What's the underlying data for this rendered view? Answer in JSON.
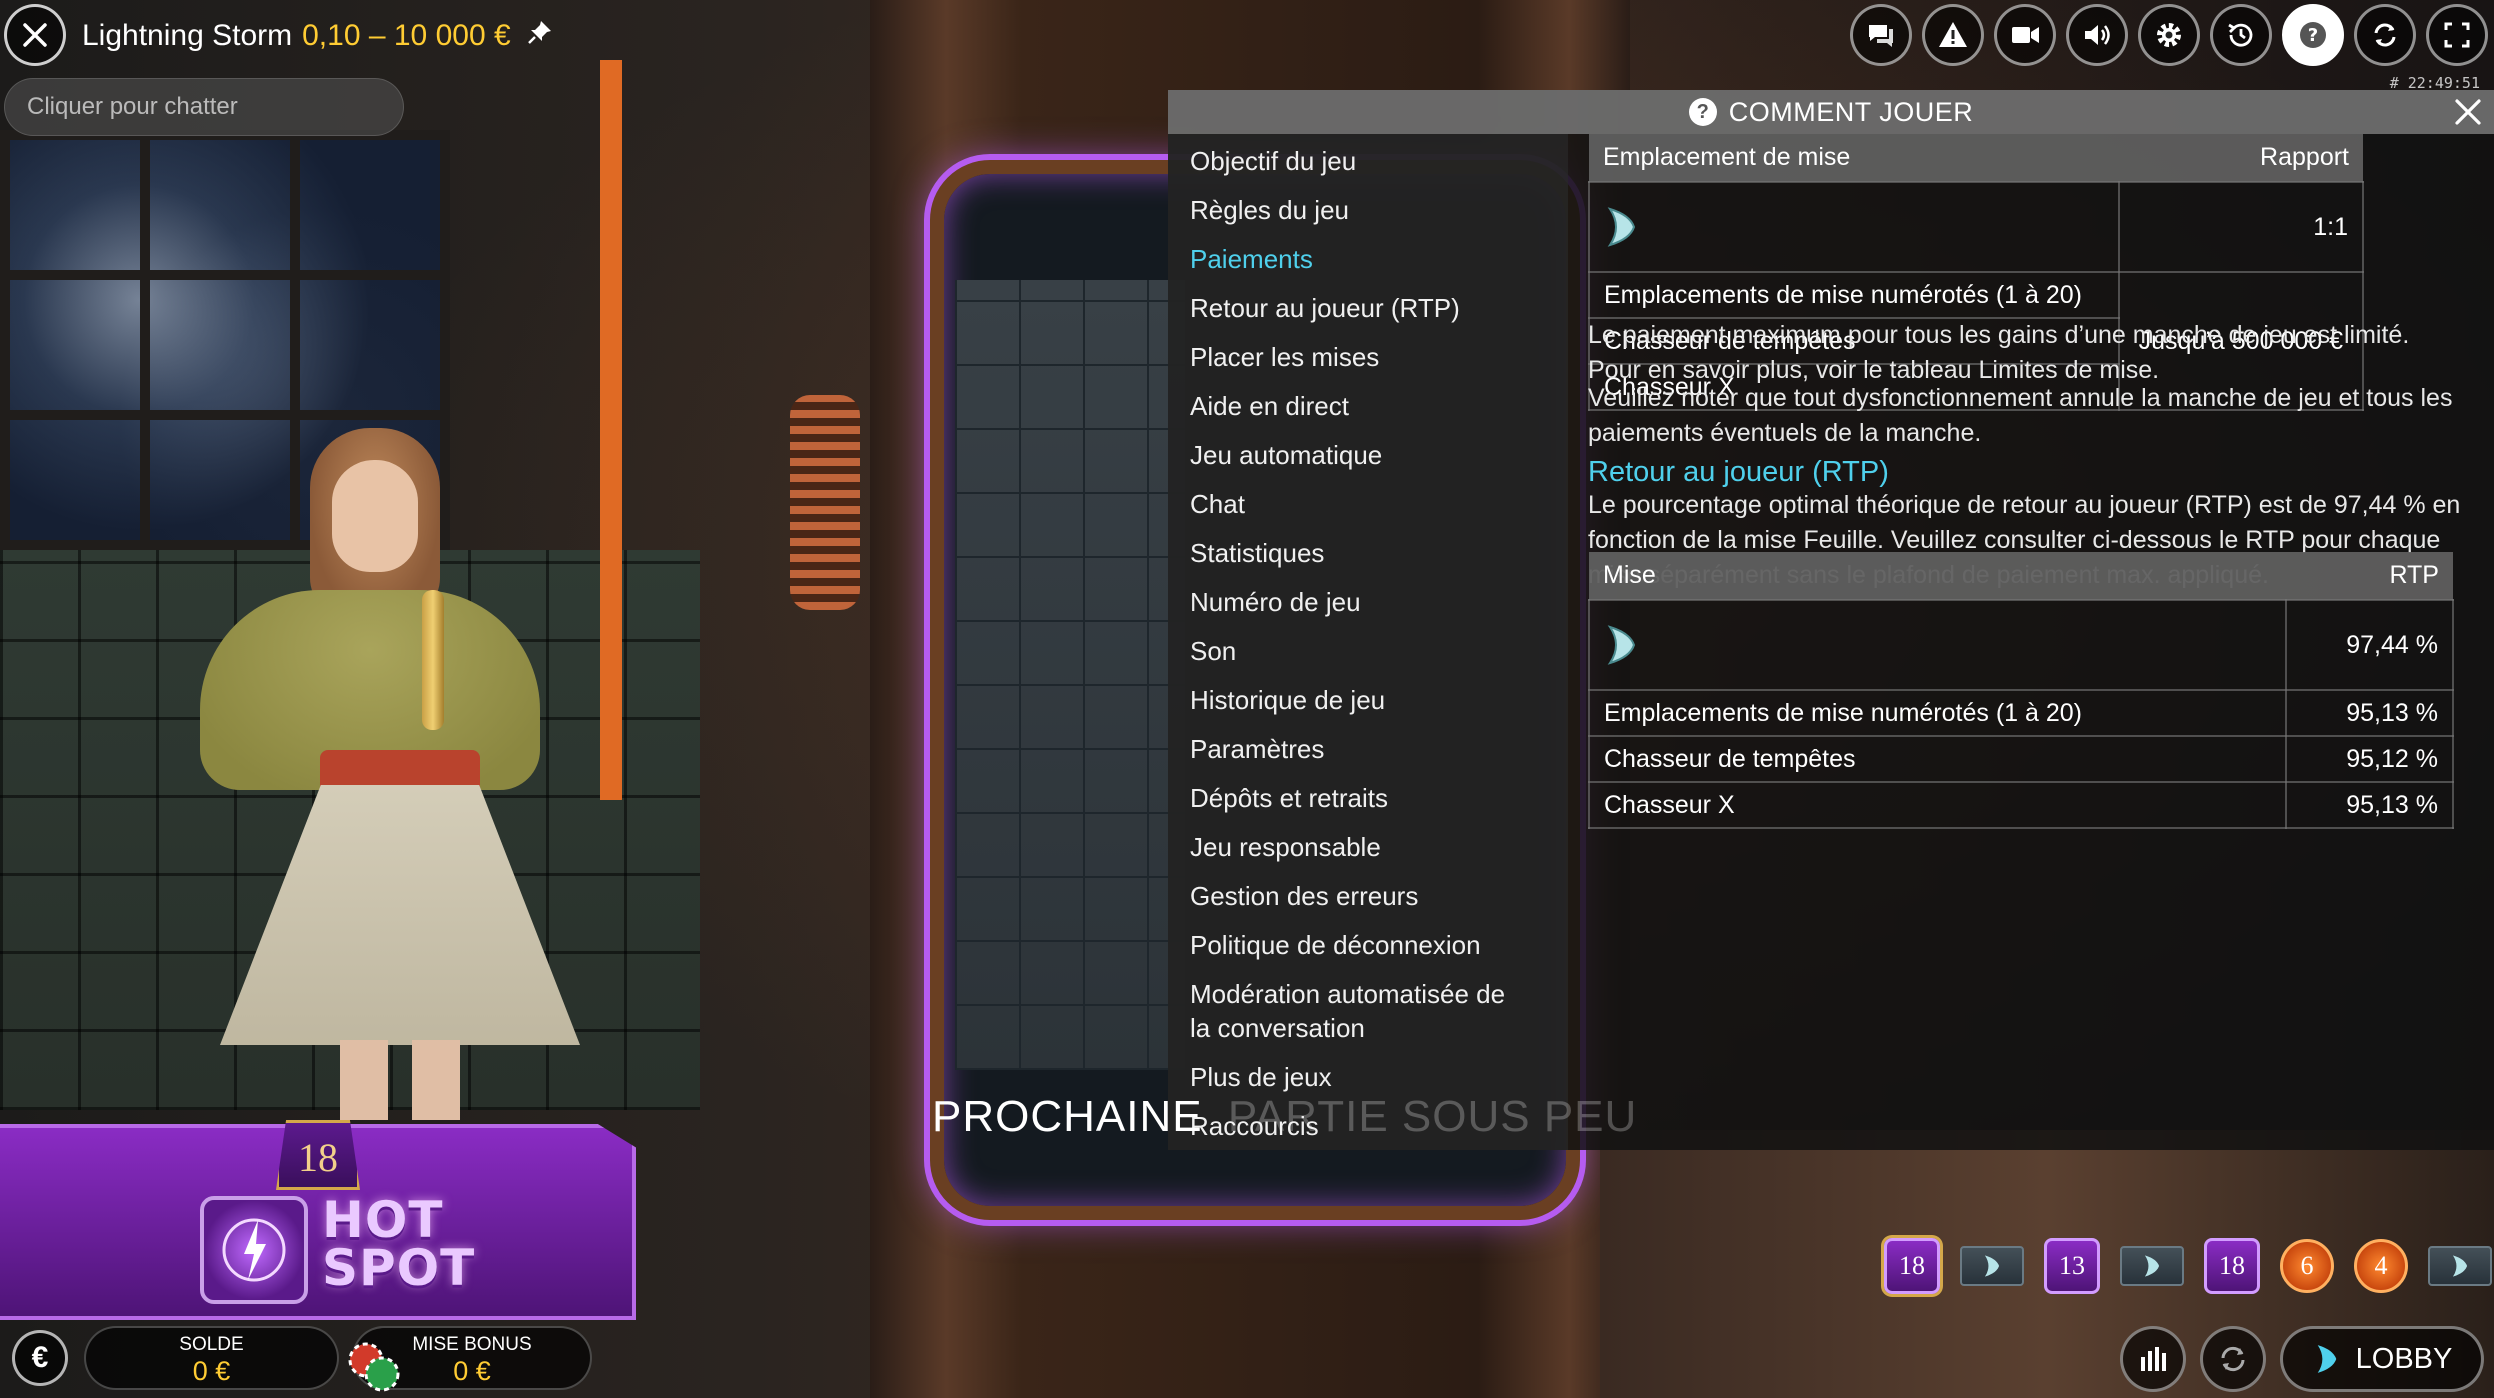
{
  "header": {
    "game_name": "Lightning Storm",
    "bet_limits": "0,10 – 10 000 €",
    "chat_placeholder": "Cliquer pour chatter",
    "clock": "# 22:49:51"
  },
  "toolbar": {
    "buttons": [
      {
        "icon": "chat-icon"
      },
      {
        "icon": "warning-icon"
      },
      {
        "icon": "video-icon"
      },
      {
        "icon": "sound-icon"
      },
      {
        "icon": "gear-icon"
      },
      {
        "icon": "history-icon"
      },
      {
        "icon": "help-icon",
        "active": true
      },
      {
        "icon": "sync-icon"
      },
      {
        "icon": "fullscreen-icon"
      }
    ]
  },
  "help": {
    "title": "COMMENT JOUER",
    "menu": [
      "Objectif du jeu",
      "Règles du jeu",
      "Paiements",
      "Retour au joueur (RTP)",
      "Placer les mises",
      "Aide en direct",
      "Jeu automatique",
      "Chat",
      "Statistiques",
      "Numéro de jeu",
      "Son",
      "Historique de jeu",
      "Paramètres",
      "Dépôts et retraits",
      "Jeu responsable",
      "Gestion des erreurs",
      "Politique de déconnexion",
      "Modération automatisée de la conversation",
      "Plus de jeux",
      "Raccourcis"
    ],
    "active_menu": "Paiements",
    "payout_table": {
      "col1": "Emplacement de mise",
      "col2": "Rapport",
      "row_leaf_ratio": "1:1",
      "row_numbered": "Emplacements de mise numérotés (1 à 20)",
      "row_storm": "Chasseur de tempêtes",
      "row_x": "Chasseur X",
      "max_ratio": "Jusqu’à 500 000 €"
    },
    "p1": "Le paiement maximum pour tous les gains d’une manche de jeu est limité. Pour en savoir plus, voir le tableau Limites de mise.",
    "p2": "Veuillez noter que tout dysfonctionnement annule la manche de jeu et tous les paiements éventuels de la manche.",
    "rtp_title": "Retour au joueur (RTP)",
    "p3": "Le pourcentage optimal théorique de retour au joueur (RTP) est de 97,44 % en fonction de la mise Feuille. Veuillez consulter ci-dessous le RTP pour chaque mise séparément sans le plafond de paiement max. appliqué.",
    "rtp_table": {
      "col1": "Mise",
      "col2": "RTP",
      "leaf_rtp": "97,44 %",
      "row_numbered": "Emplacements de mise numérotés (1 à 20)",
      "row_numbered_rtp": "95,13 %",
      "row_storm": "Chasseur de tempêtes",
      "row_storm_rtp": "95,12 %",
      "row_x": "Chasseur X",
      "row_x_rtp": "95,13 %"
    }
  },
  "banner": {
    "visible_text": "PROCHAINE",
    "faded_text": "PARTIE SOUS PEU"
  },
  "hotspot": {
    "number": "18",
    "line1": "HOT",
    "line2": "SPOT"
  },
  "balance": {
    "currency_symbol": "€",
    "solde_label": "SOLDE",
    "solde_value": "0 €",
    "bonus_label": "MISE BONUS",
    "bonus_value": "0 €"
  },
  "history": [
    {
      "type": "num",
      "value": "18"
    },
    {
      "type": "chev",
      "value": ""
    },
    {
      "type": "num",
      "value": "13"
    },
    {
      "type": "chev",
      "value": ""
    },
    {
      "type": "num",
      "value": "18"
    },
    {
      "type": "orange",
      "value": "6"
    },
    {
      "type": "orange",
      "value": "4"
    },
    {
      "type": "chev",
      "value": ""
    }
  ],
  "bottom": {
    "lobby_label": "LOBBY"
  },
  "colors": {
    "accent_cyan": "#4fd0ec",
    "gold": "#ffcc33",
    "purple": "#8a2cc4"
  }
}
